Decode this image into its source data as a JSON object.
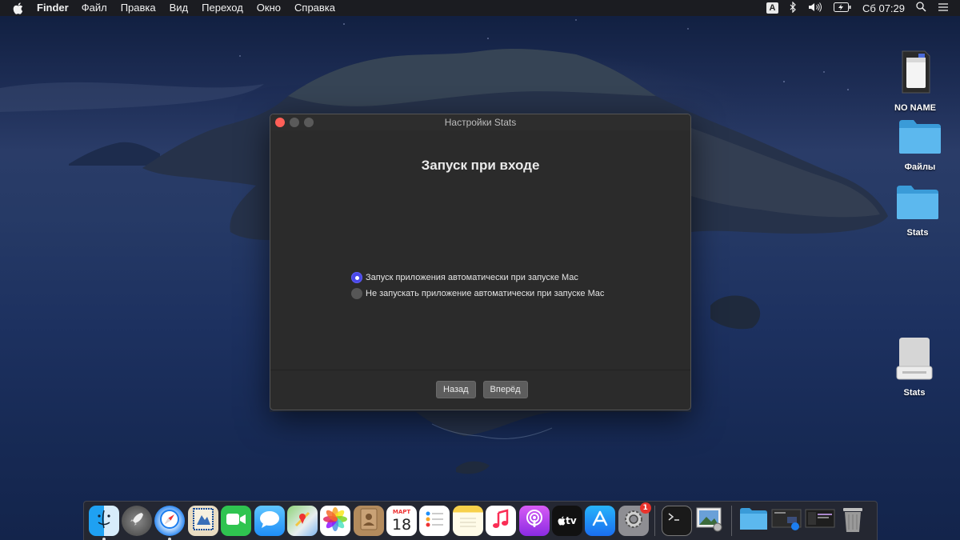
{
  "menubar": {
    "app_name": "Finder",
    "items": [
      "Файл",
      "Правка",
      "Вид",
      "Переход",
      "Окно",
      "Справка"
    ],
    "input_source": "A",
    "clock": "Сб 07:29"
  },
  "desktop": {
    "icons": [
      {
        "label": "NO NAME",
        "icon": "sd-card-icon"
      },
      {
        "label": "Файлы",
        "icon": "folder-icon"
      },
      {
        "label": "Stats",
        "icon": "folder-icon"
      },
      {
        "label": "Stats",
        "icon": "external-drive-icon"
      }
    ]
  },
  "window": {
    "title": "Настройки Stats",
    "heading": "Запуск при входе",
    "options": [
      {
        "label": "Запуск приложения автоматически при запуске Mac",
        "selected": true
      },
      {
        "label": "Не запускать приложение автоматически при запуске Mac",
        "selected": false
      }
    ],
    "back_label": "Назад",
    "next_label": "Вперёд"
  },
  "dock": {
    "calendar_month": "МАРТ",
    "calendar_day": "18",
    "tv_label": "tv",
    "settings_badge": "1"
  },
  "colors": {
    "accent": "#4a48e8",
    "window_bg": "#2b2b2b",
    "close_button": "#ff5f57"
  }
}
